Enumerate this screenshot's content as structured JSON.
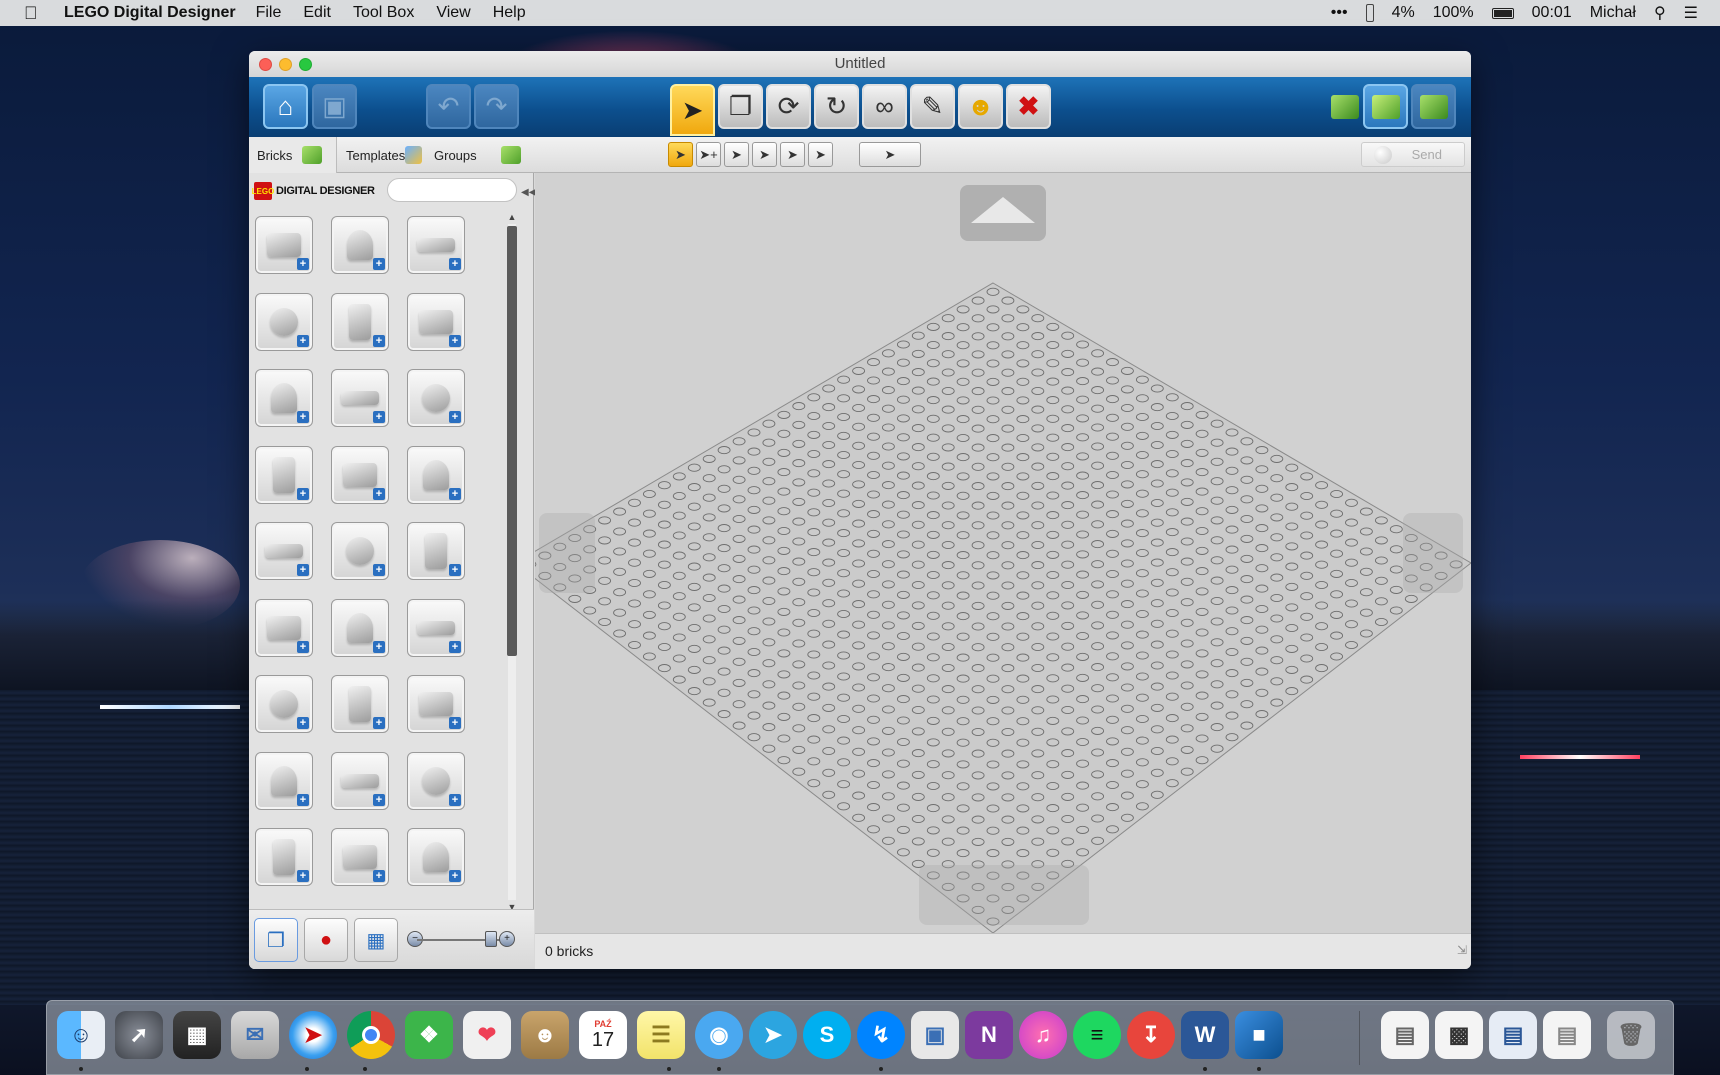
{
  "menubar": {
    "app_name": "LEGO Digital Designer",
    "menus": [
      "File",
      "Edit",
      "Tool Box",
      "View",
      "Help"
    ],
    "status": {
      "more": "•••",
      "cpu": "4%",
      "battery": "100%",
      "time": "00:01",
      "user": "Michał"
    }
  },
  "window": {
    "title": "Untitled"
  },
  "panel": {
    "tabs": [
      {
        "label": "Bricks"
      },
      {
        "label": "Templates"
      },
      {
        "label": "Groups"
      }
    ],
    "brand": {
      "logo": "LEGO",
      "label": "DIGITAL DESIGNER"
    },
    "search_placeholder": "",
    "brick_count_shown": 27
  },
  "subbar": {
    "send_label": "Send"
  },
  "status": {
    "brick_count": "0 bricks"
  },
  "colors": {
    "toolbar_blue": "#0c4f8e",
    "active_tool": "#f0a80e",
    "delete_red": "#d01012",
    "baseplate": "#cbcbcb"
  },
  "toolbar_icons": [
    "home-icon",
    "save-icon",
    "undo-icon",
    "redo-icon",
    "select-tool-icon",
    "clone-tool-icon",
    "hinge-tool-icon",
    "hinge-align-tool-icon",
    "flex-tool-icon",
    "paint-tool-icon",
    "decorate-tool-icon",
    "delete-tool-icon",
    "build-mode-icon",
    "view-mode-icon",
    "building-guide-mode-icon"
  ],
  "calendar": {
    "month": "PAŹ",
    "day": "17"
  }
}
